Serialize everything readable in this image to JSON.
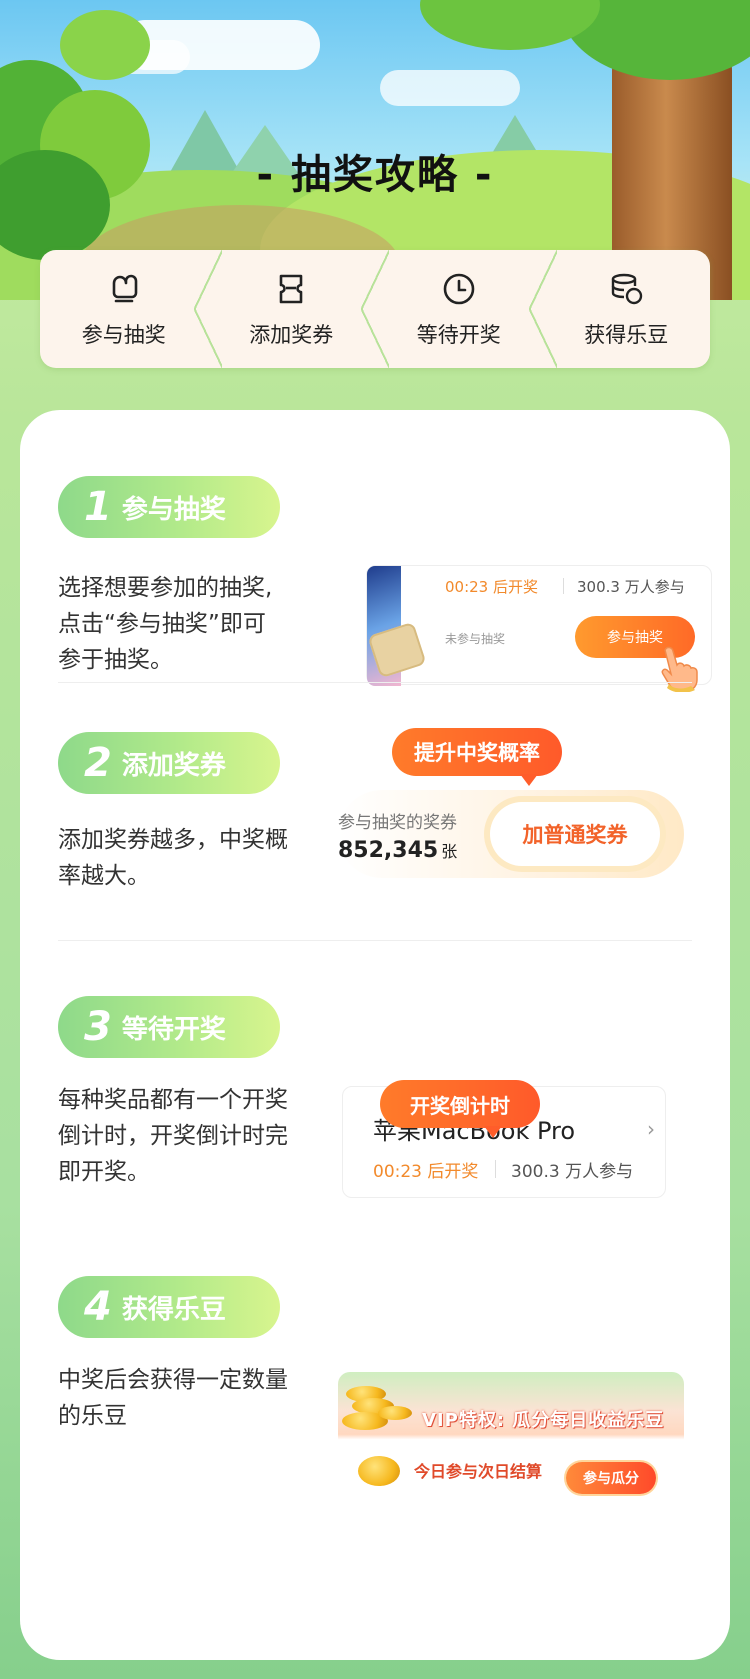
{
  "hero": {
    "title": "- 抽奖攻略 -"
  },
  "steps": [
    {
      "label": "参与抽奖",
      "icon": "mitten-icon"
    },
    {
      "label": "添加奖券",
      "icon": "ticket-icon"
    },
    {
      "label": "等待开奖",
      "icon": "clock-icon"
    },
    {
      "label": "获得乐豆",
      "icon": "coins-icon"
    }
  ],
  "sections": [
    {
      "number": "1",
      "title": "参与抽奖",
      "desc_lines": [
        "选择想要参加的抽奖,",
        "点击“参与抽奖”即可",
        "参于抽奖。"
      ],
      "preview": {
        "countdown": "00:23 后开奖",
        "participants": "300.3 万人参与",
        "status": "未参与抽奖",
        "button": "参与抽奖"
      }
    },
    {
      "number": "2",
      "title": "添加奖券",
      "desc_lines": [
        "添加奖券越多，中奖概",
        "率越大。"
      ],
      "preview": {
        "bubble": "提升中奖概率",
        "label": "参与抽奖的奖券",
        "count": "852,345",
        "unit": "张",
        "button": "加普通奖券"
      }
    },
    {
      "number": "3",
      "title": "等待开奖",
      "desc_lines": [
        "每种奖品都有一个开奖",
        "倒计时，开奖倒计时完",
        "即开奖。"
      ],
      "preview": {
        "bubble": "开奖倒计时",
        "product": "苹果MacBook Pro",
        "countdown": "00:23 后开奖",
        "participants": "300.3 万人参与"
      }
    },
    {
      "number": "4",
      "title": "获得乐豆",
      "desc_lines": [
        "中奖后会获得一定数量",
        "的乐豆"
      ],
      "preview": {
        "vip_banner": "VIP特权: 瓜分每日收益乐豆",
        "settle_text": "今日参与次日结算",
        "button": "参与瓜分"
      }
    }
  ],
  "colors": {
    "accent_orange": "#ff6a27",
    "pill_green": "#8ed98a",
    "page_green": "#b9e69a"
  }
}
